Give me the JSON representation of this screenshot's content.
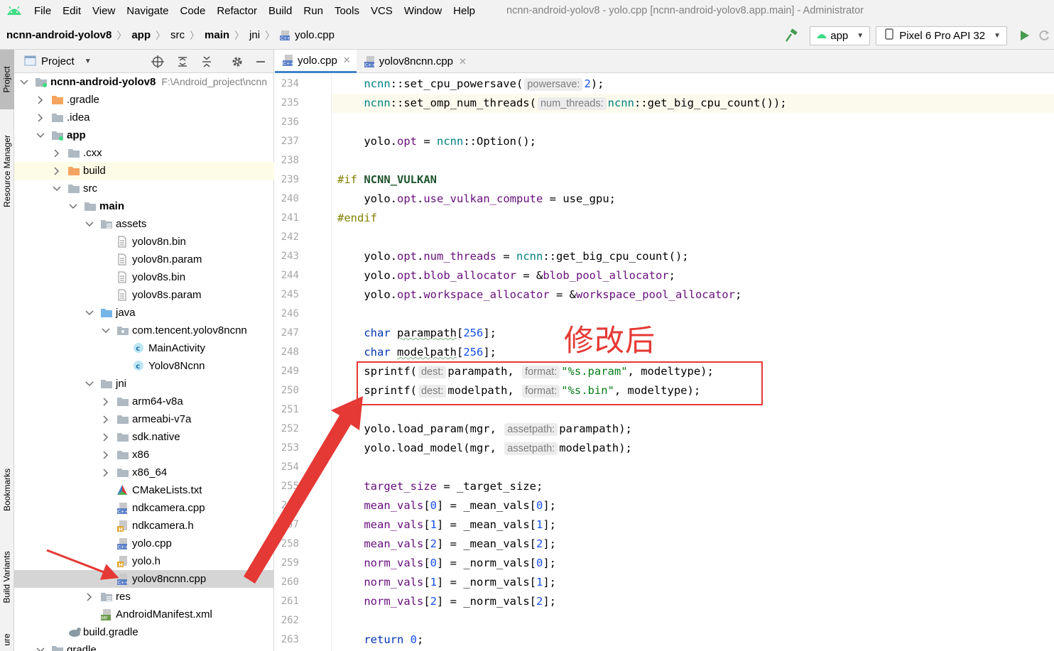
{
  "menubar": {
    "items": [
      "File",
      "Edit",
      "View",
      "Navigate",
      "Code",
      "Refactor",
      "Build",
      "Run",
      "Tools",
      "VCS",
      "Window",
      "Help"
    ],
    "window_title": "ncnn-android-yolov8 - yolo.cpp [ncnn-android-yolov8.app.main] - Administrator"
  },
  "breadcrumb": [
    "ncnn-android-yolov8",
    "app",
    "src",
    "main",
    "jni",
    "yolo.cpp"
  ],
  "run_config": {
    "module": "app",
    "device": "Pixel 6 Pro API 32"
  },
  "left_tool_windows": [
    "Project",
    "Resource Manager",
    "Bookmarks",
    "Build Variants",
    "ure"
  ],
  "project_panel": {
    "title": "Project",
    "root_path": "F:\\Android_project\\ncnn",
    "tree": [
      {
        "label": "ncnn-android-yolov8",
        "depth": 0,
        "icon": "module",
        "expanded": true,
        "bold": true
      },
      {
        "label": ".gradle",
        "depth": 1,
        "icon": "folder-orange",
        "expanded": false
      },
      {
        "label": ".idea",
        "depth": 1,
        "icon": "folder",
        "expanded": false
      },
      {
        "label": "app",
        "depth": 1,
        "icon": "module",
        "expanded": true,
        "bold": true
      },
      {
        "label": ".cxx",
        "depth": 2,
        "icon": "folder",
        "expanded": false
      },
      {
        "label": "build",
        "depth": 2,
        "icon": "folder-orange",
        "expanded": false
      },
      {
        "label": "src",
        "depth": 2,
        "icon": "folder",
        "expanded": true
      },
      {
        "label": "main",
        "depth": 3,
        "icon": "folder",
        "expanded": true,
        "bold": true
      },
      {
        "label": "assets",
        "depth": 4,
        "icon": "folder-res",
        "expanded": true
      },
      {
        "label": "yolov8n.bin",
        "depth": 5,
        "icon": "file"
      },
      {
        "label": "yolov8n.param",
        "depth": 5,
        "icon": "file"
      },
      {
        "label": "yolov8s.bin",
        "depth": 5,
        "icon": "file"
      },
      {
        "label": "yolov8s.param",
        "depth": 5,
        "icon": "file"
      },
      {
        "label": "java",
        "depth": 4,
        "icon": "folder-blue",
        "expanded": true
      },
      {
        "label": "com.tencent.yolov8ncnn",
        "depth": 5,
        "icon": "package",
        "expanded": true
      },
      {
        "label": "MainActivity",
        "depth": 6,
        "icon": "class"
      },
      {
        "label": "Yolov8Ncnn",
        "depth": 6,
        "icon": "class"
      },
      {
        "label": "jni",
        "depth": 4,
        "icon": "folder",
        "expanded": true
      },
      {
        "label": "arm64-v8a",
        "depth": 5,
        "icon": "folder",
        "expanded": false
      },
      {
        "label": "armeabi-v7a",
        "depth": 5,
        "icon": "folder",
        "expanded": false
      },
      {
        "label": "sdk.native",
        "depth": 5,
        "icon": "folder",
        "expanded": false
      },
      {
        "label": "x86",
        "depth": 5,
        "icon": "folder",
        "expanded": false
      },
      {
        "label": "x86_64",
        "depth": 5,
        "icon": "folder",
        "expanded": false
      },
      {
        "label": "CMakeLists.txt",
        "depth": 5,
        "icon": "cmake"
      },
      {
        "label": "ndkcamera.cpp",
        "depth": 5,
        "icon": "cpp"
      },
      {
        "label": "ndkcamera.h",
        "depth": 5,
        "icon": "h"
      },
      {
        "label": "yolo.cpp",
        "depth": 5,
        "icon": "cpp"
      },
      {
        "label": "yolo.h",
        "depth": 5,
        "icon": "h"
      },
      {
        "label": "yolov8ncnn.cpp",
        "depth": 5,
        "icon": "cpp",
        "selected": true
      },
      {
        "label": "res",
        "depth": 4,
        "icon": "folder-res",
        "expanded": false
      },
      {
        "label": "AndroidManifest.xml",
        "depth": 4,
        "icon": "manifest"
      },
      {
        "label": "build.gradle",
        "depth": 2,
        "icon": "gradle"
      },
      {
        "label": "gradle",
        "depth": 1,
        "icon": "folder",
        "expanded": true
      }
    ]
  },
  "editor_tabs": [
    {
      "label": "yolo.cpp",
      "active": true
    },
    {
      "label": "yolov8ncnn.cpp",
      "active": false
    }
  ],
  "editor": {
    "first_line": 234,
    "lines": [
      [
        [
          "    "
        ],
        [
          "ncnn",
          "ns"
        ],
        [
          "::"
        ],
        [
          "set_cpu_powersave",
          ""
        ],
        [
          "("
        ],
        [
          "powersave:",
          "hint"
        ],
        [
          "2",
          "num"
        ],
        [
          ");"
        ]
      ],
      [
        [
          "    "
        ],
        [
          "ncnn",
          "ns"
        ],
        [
          "::"
        ],
        [
          "set_omp_num_threads("
        ],
        [
          "num_threads:",
          "hint"
        ],
        [
          "ncnn",
          "ns"
        ],
        [
          "::"
        ],
        [
          "get_big_cpu_count());"
        ]
      ],
      [
        [
          ""
        ]
      ],
      [
        [
          "    yolo."
        ],
        [
          "opt",
          "mem"
        ],
        [
          " = "
        ],
        [
          "ncnn",
          "ns"
        ],
        [
          "::Option();"
        ]
      ],
      [
        [
          ""
        ]
      ],
      [
        [
          "#if ",
          "pp"
        ],
        [
          "NCNN_VULKAN",
          "mac"
        ]
      ],
      [
        [
          "    yolo."
        ],
        [
          "opt",
          "mem"
        ],
        [
          "."
        ],
        [
          "use_vulkan_compute",
          "mem"
        ],
        [
          " = use_gpu;"
        ]
      ],
      [
        [
          "#endif",
          "pp"
        ]
      ],
      [
        [
          ""
        ]
      ],
      [
        [
          "    yolo."
        ],
        [
          "opt",
          "mem"
        ],
        [
          "."
        ],
        [
          "num_threads",
          "mem"
        ],
        [
          " = "
        ],
        [
          "ncnn",
          "ns"
        ],
        [
          "::get_big_cpu_count();"
        ]
      ],
      [
        [
          "    yolo."
        ],
        [
          "opt",
          "mem"
        ],
        [
          "."
        ],
        [
          "blob_allocator",
          "mem"
        ],
        [
          " = &"
        ],
        [
          "blob_pool_allocator",
          "mem"
        ],
        [
          ";"
        ]
      ],
      [
        [
          "    yolo."
        ],
        [
          "opt",
          "mem"
        ],
        [
          "."
        ],
        [
          "workspace_allocator",
          "mem"
        ],
        [
          " = &"
        ],
        [
          "workspace_pool_allocator",
          "mem"
        ],
        [
          ";"
        ]
      ],
      [
        [
          ""
        ]
      ],
      [
        [
          "    "
        ],
        [
          "char",
          "kw"
        ],
        [
          " "
        ],
        [
          "parampath",
          "squig"
        ],
        [
          "["
        ],
        [
          "256",
          "num"
        ],
        [
          "];"
        ]
      ],
      [
        [
          "    "
        ],
        [
          "char",
          "kw"
        ],
        [
          " "
        ],
        [
          "modelpath",
          "squig"
        ],
        [
          "["
        ],
        [
          "256",
          "num"
        ],
        [
          "];"
        ]
      ],
      [
        [
          "    sprintf("
        ],
        [
          "dest:",
          "hint"
        ],
        [
          "parampath, "
        ],
        [
          "format:",
          "hint"
        ],
        [
          "\"%s.param\"",
          "str"
        ],
        [
          ", modeltype);"
        ]
      ],
      [
        [
          "    sprintf("
        ],
        [
          "dest:",
          "hint"
        ],
        [
          "modelpath, "
        ],
        [
          "format:",
          "hint"
        ],
        [
          "\"%s.bin\"",
          "str"
        ],
        [
          ", modeltype);"
        ]
      ],
      [
        [
          ""
        ]
      ],
      [
        [
          "    yolo.load_param(mgr, "
        ],
        [
          "assetpath:",
          "hint"
        ],
        [
          "parampath);"
        ]
      ],
      [
        [
          "    yolo.load_model(mgr, "
        ],
        [
          "assetpath:",
          "hint"
        ],
        [
          "modelpath);"
        ]
      ],
      [
        [
          ""
        ]
      ],
      [
        [
          "    "
        ],
        [
          "target_size",
          "mem"
        ],
        [
          " = _target_size;"
        ]
      ],
      [
        [
          "    "
        ],
        [
          "mean_vals",
          "mem"
        ],
        [
          "["
        ],
        [
          "0",
          "num"
        ],
        [
          "] = _mean_vals["
        ],
        [
          "0",
          "num"
        ],
        [
          "];"
        ]
      ],
      [
        [
          "    "
        ],
        [
          "mean_vals",
          "mem"
        ],
        [
          "["
        ],
        [
          "1",
          "num"
        ],
        [
          "] = _mean_vals["
        ],
        [
          "1",
          "num"
        ],
        [
          "];"
        ]
      ],
      [
        [
          "    "
        ],
        [
          "mean_vals",
          "mem"
        ],
        [
          "["
        ],
        [
          "2",
          "num"
        ],
        [
          "] = _mean_vals["
        ],
        [
          "2",
          "num"
        ],
        [
          "];"
        ]
      ],
      [
        [
          "    "
        ],
        [
          "norm_vals",
          "mem"
        ],
        [
          "["
        ],
        [
          "0",
          "num"
        ],
        [
          "] = _norm_vals["
        ],
        [
          "0",
          "num"
        ],
        [
          "];"
        ]
      ],
      [
        [
          "    "
        ],
        [
          "norm_vals",
          "mem"
        ],
        [
          "["
        ],
        [
          "1",
          "num"
        ],
        [
          "] = _norm_vals["
        ],
        [
          "1",
          "num"
        ],
        [
          "];"
        ]
      ],
      [
        [
          "    "
        ],
        [
          "norm_vals",
          "mem"
        ],
        [
          "["
        ],
        [
          "2",
          "num"
        ],
        [
          "] = _norm_vals["
        ],
        [
          "2",
          "num"
        ],
        [
          "];"
        ]
      ],
      [
        [
          ""
        ]
      ],
      [
        [
          "    "
        ],
        [
          "return",
          "kw"
        ],
        [
          " "
        ],
        [
          "0",
          "num"
        ],
        [
          ";"
        ]
      ]
    ]
  },
  "annotation": {
    "text": "修改后",
    "color": "#e53935"
  },
  "colors": {
    "accent": "#4083c9",
    "selection": "#d5d5d5",
    "annotation": "#e53935"
  }
}
